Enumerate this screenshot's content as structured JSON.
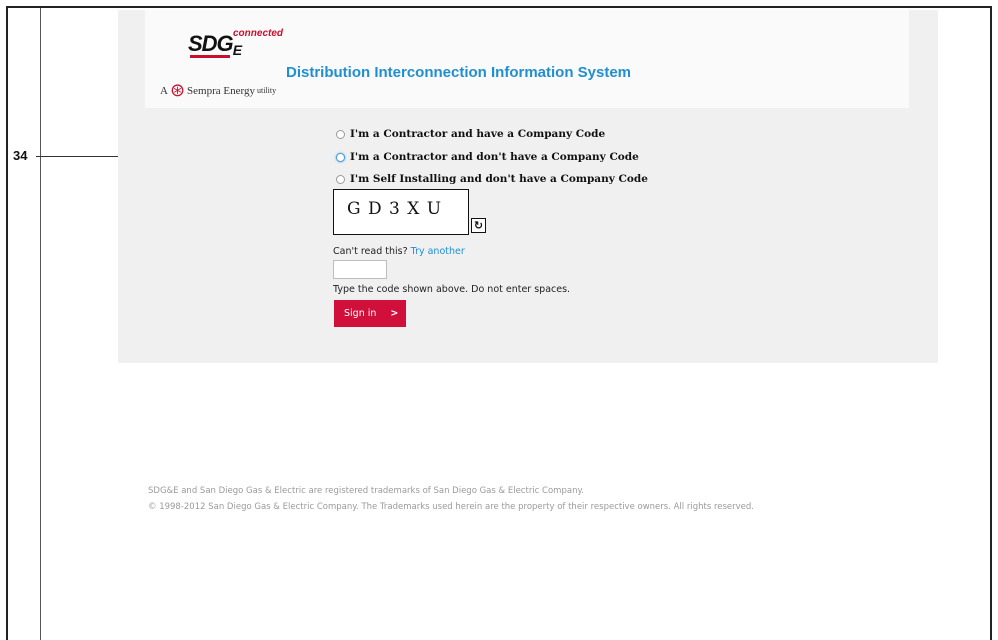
{
  "callout": {
    "number": "34"
  },
  "brand": {
    "logo_main": "SDG",
    "logo_sub": "E",
    "logo_connected": "connected",
    "sempra_prefix": "A",
    "sempra_name": "Sempra Energy",
    "sempra_suffix": "utility"
  },
  "header": {
    "title": "Distribution Interconnection Information System"
  },
  "options": [
    {
      "label": "I'm a Contractor and have a Company Code",
      "selected": false
    },
    {
      "label": "I'm a Contractor and don't have a Company Code",
      "selected": true
    },
    {
      "label": "I'm Self Installing and don't have a Company Code",
      "selected": false
    }
  ],
  "captcha": {
    "code_display": "G D 3 X U",
    "cant_read": "Can't read this?",
    "try_another": "Try another",
    "input_value": "",
    "instruction": "Type the code shown above. Do not enter spaces."
  },
  "signin": {
    "label": "Sign in",
    "chevron": ">"
  },
  "footer": {
    "line1": "SDG&E and San Diego Gas & Electric are registered trademarks of San Diego Gas & Electric Company.",
    "line2": "© 1998-2012 San Diego Gas & Electric Company. The Trademarks used herein are the property of their respective owners. All rights reserved."
  },
  "colors": {
    "accent_blue": "#1f8fd0",
    "signin_red": "#d0103a",
    "brand_red": "#c8102e"
  },
  "icons": [
    "refresh-icon",
    "radio-icon"
  ]
}
